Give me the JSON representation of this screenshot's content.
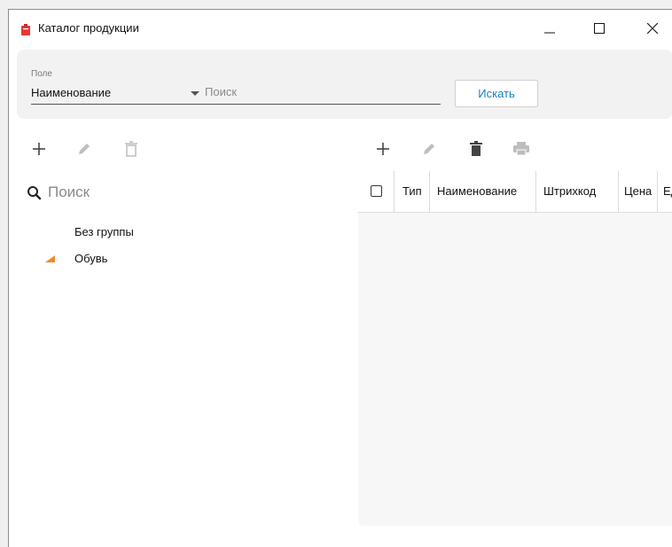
{
  "window": {
    "title": "Каталог продукции"
  },
  "filter": {
    "field_label": "Поле",
    "field_value": "Наименование",
    "search_placeholder": "Поиск",
    "search_button": "Искать"
  },
  "tree": {
    "search_placeholder": "Поиск",
    "items": [
      {
        "label": "Без группы",
        "expanded": false
      },
      {
        "label": "Обувь",
        "expanded": true
      }
    ]
  },
  "grid": {
    "columns": [
      "Тип",
      "Наименование",
      "Штрихкод",
      "Цена",
      "Ед"
    ],
    "rows": []
  },
  "icons": {
    "tree_toolbar": [
      "plus-icon",
      "pencil-icon",
      "trash-outline-icon"
    ],
    "grid_toolbar": [
      "plus-icon",
      "pencil-icon",
      "trash-icon",
      "printer-icon"
    ]
  },
  "colors": {
    "accent": "#1a7fc0",
    "tree_expand": "#f08a24",
    "app_icon": "#e53935"
  }
}
